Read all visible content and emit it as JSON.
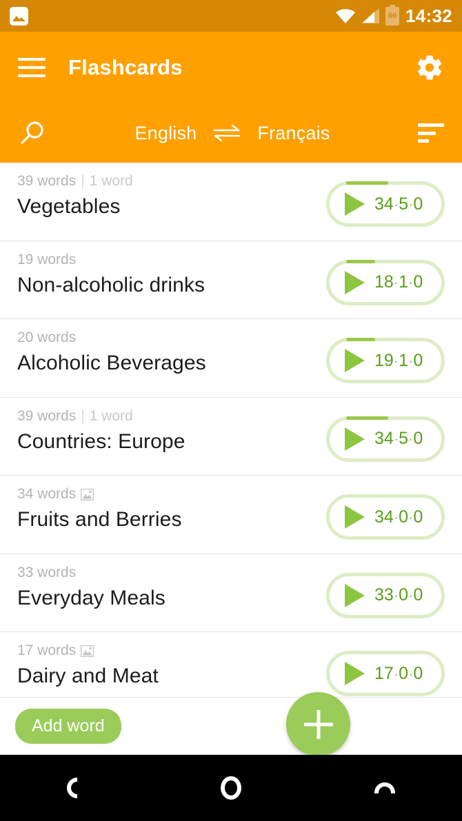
{
  "status_bar": {
    "notification_icon": "photo-icon",
    "wifi_icon": "wifi-icon",
    "signal_icon": "cellular-signal-icon",
    "battery_level": "66",
    "clock": "14:32"
  },
  "app_bar": {
    "menu_icon": "hamburger-menu-icon",
    "title": "Flashcards",
    "settings_icon": "gear-icon",
    "search_icon": "search-icon",
    "source_language": "English",
    "swap_icon": "swap-arrows-icon",
    "target_language": "Français",
    "sort_icon": "sort-icon"
  },
  "colors": {
    "status_bar": "#d48806",
    "app_bar": "#ffa000",
    "accent_green": "#9bcc5a",
    "play_green": "#8cc63f",
    "badge_border": "#deecc4",
    "count_text": "#5a9e17"
  },
  "list": [
    {
      "word_count": "39 words",
      "separator": "|",
      "new_count": "1 word",
      "has_image": false,
      "title": "Vegetables",
      "learned": "34",
      "learning": "5",
      "unknown": "0",
      "progress_pct": 13,
      "play_icon": "play-icon"
    },
    {
      "word_count": "19 words",
      "separator": "",
      "new_count": "",
      "has_image": false,
      "title": "Non-alcoholic drinks",
      "learned": "18",
      "learning": "1",
      "unknown": "0",
      "progress_pct": 6,
      "play_icon": "play-icon"
    },
    {
      "word_count": "20 words",
      "separator": "",
      "new_count": "",
      "has_image": false,
      "title": "Alcoholic Beverages",
      "learned": "19",
      "learning": "1",
      "unknown": "0",
      "progress_pct": 6,
      "play_icon": "play-icon"
    },
    {
      "word_count": "39 words",
      "separator": "|",
      "new_count": "1 word",
      "has_image": false,
      "title": "Countries: Europe",
      "learned": "34",
      "learning": "5",
      "unknown": "0",
      "progress_pct": 13,
      "play_icon": "play-icon"
    },
    {
      "word_count": "34 words",
      "separator": "",
      "new_count": "",
      "has_image": true,
      "title": "Fruits and Berries",
      "learned": "34",
      "learning": "0",
      "unknown": "0",
      "progress_pct": 0,
      "play_icon": "play-icon"
    },
    {
      "word_count": "33 words",
      "separator": "",
      "new_count": "",
      "has_image": false,
      "title": "Everyday Meals",
      "learned": "33",
      "learning": "0",
      "unknown": "0",
      "progress_pct": 0,
      "play_icon": "play-icon"
    },
    {
      "word_count": "17 words",
      "separator": "",
      "new_count": "",
      "has_image": true,
      "title": "Dairy and Meat",
      "learned": "17",
      "learning": "0",
      "unknown": "0",
      "progress_pct": 0,
      "play_icon": "play-icon"
    }
  ],
  "bottom_bar": {
    "add_word_label": "Add word",
    "fab_icon": "plus-icon"
  },
  "nav_bar": {
    "back_icon": "back-icon",
    "home_icon": "home-icon",
    "recents_icon": "recents-icon"
  }
}
